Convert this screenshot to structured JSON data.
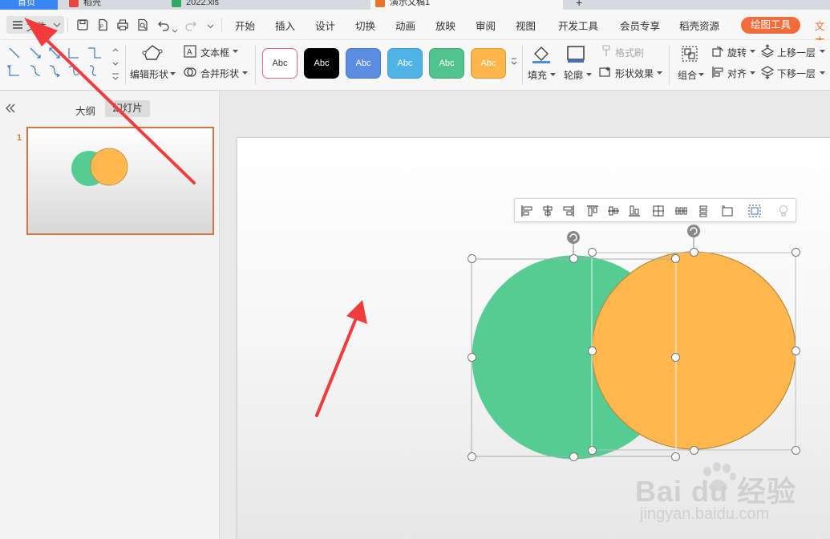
{
  "tabs": [
    {
      "label": "首页",
      "color": "#2f7ae5"
    },
    {
      "label": "稻壳",
      "color": "#e84545"
    },
    {
      "label": "2022.xls",
      "color": "#2fa860"
    },
    {
      "label": "演示文稿1",
      "color": "#e8742e"
    }
  ],
  "menu": {
    "file_label": "文件",
    "items": [
      "开始",
      "插入",
      "设计",
      "切换",
      "动画",
      "放映",
      "审阅",
      "视图",
      "开发工具",
      "会员专享",
      "稻壳资源"
    ],
    "drawing_tools_tab": "绘图工具",
    "text_tools_tab": "文本"
  },
  "ribbon": {
    "edit_shape": "编辑形状",
    "text_box": "文本框",
    "merge_shape": "合并形状",
    "style_label": "Abc",
    "style_colors": {
      "white": "#ffffff",
      "black": "#000000",
      "blue": "#5b8ee3",
      "lightblue": "#4fb3e6",
      "green": "#52c38f",
      "orange": "#ffb74d",
      "red_border": "#e06a7a"
    },
    "fill": "填充",
    "outline": "轮廓",
    "format_painter": "格式刷",
    "shape_effect": "形状效果",
    "group": "组合",
    "rotate": "旋转",
    "align": "对齐",
    "bring_forward": "上移一层",
    "send_backward": "下移一层"
  },
  "left_panel": {
    "collapse_icon": "double-chevron-left-icon",
    "tab_outline": "大纲",
    "tab_slides": "幻灯片",
    "slide_number": "1"
  },
  "shapes": {
    "green_circle_color": "#55cc94",
    "orange_circle_color": "#ffb74e",
    "orange_circle_stroke": "#b88a3f"
  },
  "annotations": {
    "arrow_color": "#f03c3c"
  },
  "watermark": {
    "brand": "Bai du 经验",
    "url": "jingyan.baidu.com"
  }
}
